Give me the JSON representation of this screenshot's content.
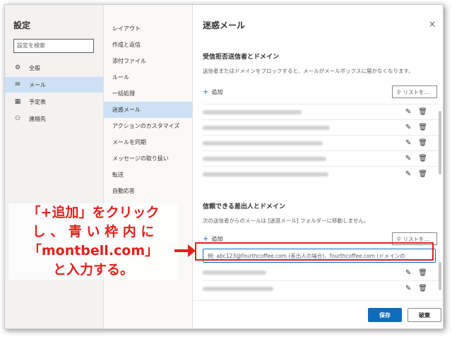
{
  "settings": {
    "title": "設定",
    "search_placeholder": "設定を検索"
  },
  "nav": [
    {
      "icon": "gear-icon",
      "glyph": "⚙",
      "label": "全般"
    },
    {
      "icon": "mail-icon",
      "glyph": "✉",
      "label": "メール"
    },
    {
      "icon": "calendar-icon",
      "glyph": "▦",
      "label": "予定表"
    },
    {
      "icon": "people-icon",
      "glyph": "⚇",
      "label": "連絡先"
    }
  ],
  "mail_menu": [
    "レイアウト",
    "作成と返信",
    "添付ファイル",
    "ルール",
    "一括処理",
    "迷惑メール",
    "アクションのカスタマイズ",
    "メールを同期",
    "メッセージの取り扱い",
    "転送",
    "自動応答"
  ],
  "panel": {
    "title": "迷惑メール",
    "close": "×",
    "blocked": {
      "title": "受信拒否送信者とドメイン",
      "desc": "送信者またはドメインをブロックすると、メールがメールボックスに届かなくなります。",
      "add": "追加",
      "search": "リストを…"
    },
    "safe": {
      "title": "信頼できる差出人とドメイン",
      "desc": "次の送信者からのメールは [迷惑メール] フォルダーに移動しません。",
      "add": "追加",
      "search": "リストを…",
      "input_placeholder": "例: abc123@fourthcoffee.com (差出人の場合)、fourthcoffee.com (ドメインの"
    },
    "save": "保存",
    "discard": "破棄"
  },
  "annotation": {
    "line1": "「+追加」をクリック",
    "line2": "し 、 青 い 枠 内 に",
    "line3": "「montbell.com」",
    "line4": "と入力する。"
  },
  "colors": {
    "accent": "#0f6cbd",
    "annotation_red": "#e6201c",
    "active_bg": "#cce2f4"
  }
}
